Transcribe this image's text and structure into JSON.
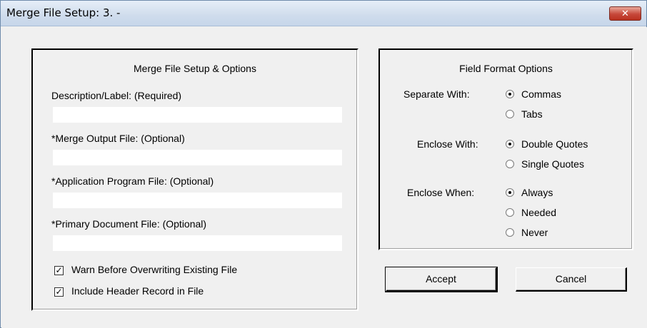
{
  "window": {
    "title": "Merge File Setup:  3. -",
    "close_glyph": "✕"
  },
  "setup": {
    "title": "Merge File Setup & Options",
    "description_label": "Description/Label: (Required)",
    "description_value": "",
    "output_label": "*Merge Output File: (Optional)",
    "output_value": "",
    "program_label": "*Application Program File: (Optional)",
    "program_value": "",
    "primary_label": "*Primary Document File: (Optional)",
    "primary_value": "",
    "warn_label": "Warn Before Overwriting Existing File",
    "warn_checked": true,
    "header_label": "Include Header Record in File",
    "header_checked": true,
    "check_glyph": "✓"
  },
  "format": {
    "title": "Field Format Options",
    "separate_label": "Separate With:",
    "separate_options": [
      "Commas",
      "Tabs"
    ],
    "separate_selected": "Commas",
    "enclose_label": "Enclose With:",
    "enclose_options": [
      "Double Quotes",
      "Single Quotes"
    ],
    "enclose_selected": "Double Quotes",
    "when_label": "Enclose When:",
    "when_options": [
      "Always",
      "Needed",
      "Never"
    ],
    "when_selected": "Always"
  },
  "buttons": {
    "accept": "Accept",
    "cancel": "Cancel"
  }
}
